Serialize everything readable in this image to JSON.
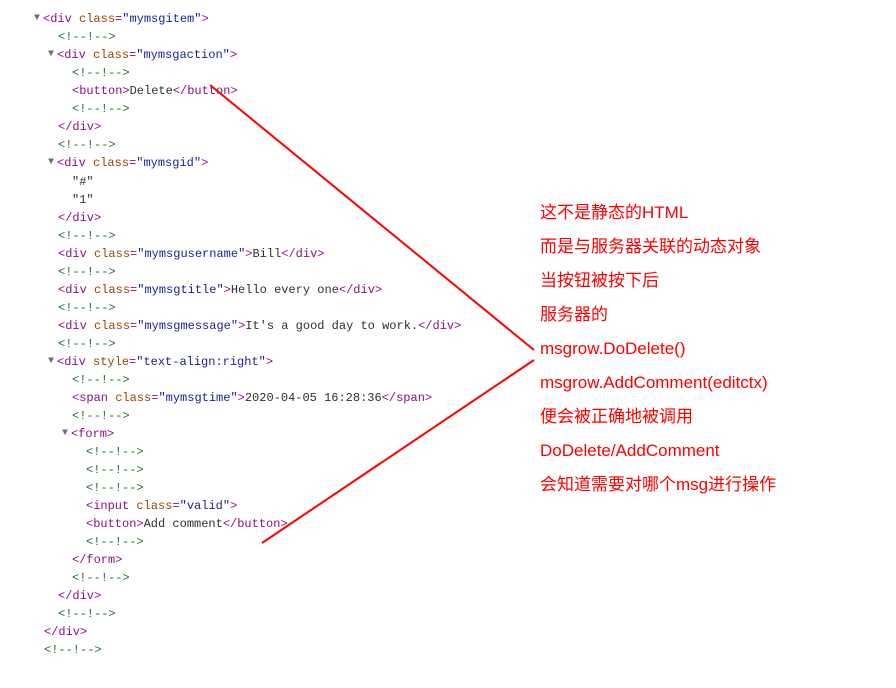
{
  "code": {
    "class_item": "mymsgitem",
    "class_action": "mymsgaction",
    "btn_delete": "Delete",
    "class_id": "mymsgid",
    "id_hash": "\"#\"",
    "id_num": "\"1\"",
    "class_username": "mymsgusername",
    "username_text": "Bill",
    "class_title": "mymsgtitle",
    "title_text": "Hello every one",
    "class_message": "mymsgmessage",
    "message_text": "It's a good day to work.",
    "style_right": "text-align:right",
    "class_time": "mymsgtime",
    "time_text": "2020-04-05 16:28:36",
    "class_valid": "valid",
    "btn_addcomment": "Add comment",
    "comment": "<!--!-->",
    "open_div_nc": "<div",
    "open_div_close": ">",
    "close_div": "</div>",
    "open_span": "<span",
    "close_span": "</span>",
    "open_button": "<button>",
    "close_button": "</button>",
    "open_form": "<form>",
    "close_form": "</form>",
    "input_tag": "<input",
    "class_kw": "class",
    "style_kw": "style",
    "eq": "="
  },
  "annotation": {
    "l1": "这不是静态的HTML",
    "l2": "而是与服务器关联的动态对象",
    "l3": "当按钮被按下后",
    "l4": "服务器的",
    "l5": "msgrow.DoDelete()",
    "l6": "msgrow.AddComment(editctx)",
    "l7": "便会被正确地被调用",
    "l8": "DoDelete/AddComment",
    "l9": "会知道需要对哪个msg进行操作"
  }
}
